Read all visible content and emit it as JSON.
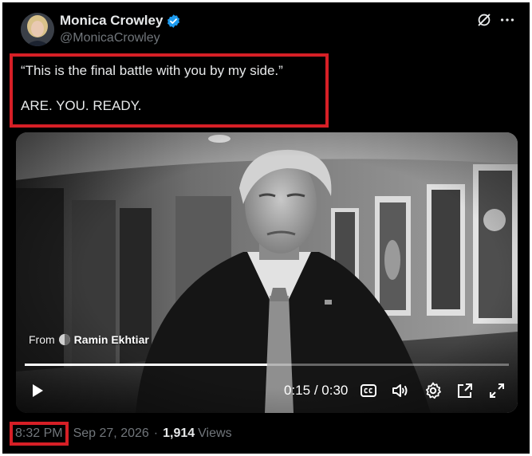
{
  "author": {
    "name": "Monica Crowley",
    "handle": "@MonicaCrowley",
    "verified": true
  },
  "tweet": {
    "line1": "“This is the final battle with you by my side.”",
    "line2": "ARE. YOU. READY."
  },
  "video": {
    "attribution_prefix": "From",
    "attribution_name": "Ramin Ekhtiar",
    "current_time": "0:15",
    "separator": "/",
    "duration": "0:30",
    "progress_fraction": 0.5
  },
  "meta": {
    "time": "8:32 PM",
    "date": "Sep 27, 2026",
    "dot": "·",
    "view_count": "1,914",
    "views_label": "Views"
  },
  "icons": {
    "grok": "grok-icon",
    "more": "more-icon",
    "verified": "verified-badge-icon",
    "play": "play-icon",
    "captions": "captions-icon",
    "volume": "volume-icon",
    "settings": "settings-icon",
    "popout": "popout-icon",
    "fullscreen": "fullscreen-icon"
  },
  "colors": {
    "background": "#000000",
    "highlight_red": "#d61f26",
    "verified_blue": "#1d9bf0",
    "primary_text": "#e7e9ea",
    "secondary_text": "#71767b"
  }
}
